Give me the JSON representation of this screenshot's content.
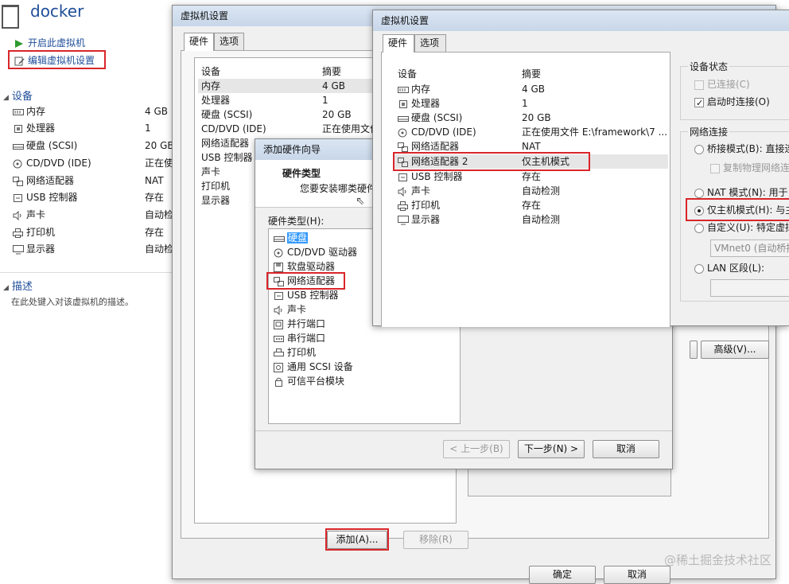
{
  "left_panel": {
    "vm_name": "docker",
    "actions": [
      {
        "label": "开启此虚拟机",
        "icon": "play-icon"
      },
      {
        "label": "编辑虚拟机设置",
        "icon": "edit-settings-icon"
      }
    ],
    "devices_section": "设备",
    "devices": [
      {
        "name": "内存",
        "value": "4 GB",
        "icon": "memory-icon"
      },
      {
        "name": "处理器",
        "value": "1",
        "icon": "processor-icon"
      },
      {
        "name": "硬盘 (SCSI)",
        "value": "20 GB",
        "icon": "hard-disk-icon"
      },
      {
        "name": "CD/DVD (IDE)",
        "value": "正在使",
        "icon": "cd-dvd-icon"
      },
      {
        "name": "网络适配器",
        "value": "NAT",
        "icon": "network-adapter-icon"
      },
      {
        "name": "USB 控制器",
        "value": "存在",
        "icon": "usb-icon"
      },
      {
        "name": "声卡",
        "value": "自动检",
        "icon": "sound-card-icon"
      },
      {
        "name": "打印机",
        "value": "存在",
        "icon": "printer-icon"
      },
      {
        "name": "显示器",
        "value": "自动检",
        "icon": "display-icon"
      }
    ],
    "description_section": "描述",
    "description_placeholder": "在此处键入对该虚拟机的描述。"
  },
  "settings_dialog": {
    "title": "虚拟机设置",
    "tabs": [
      "硬件",
      "选项"
    ],
    "col_device": "设备",
    "col_summary": "摘要",
    "devices": [
      {
        "name": "内存",
        "summary": "4 GB"
      },
      {
        "name": "处理器",
        "summary": "1"
      },
      {
        "name": "硬盘 (SCSI)",
        "summary": "20 GB"
      },
      {
        "name": "CD/DVD (IDE)",
        "summary": "正在使用文件"
      },
      {
        "name": "网络适配器",
        "summary": ""
      },
      {
        "name": "USB 控制器",
        "summary": ""
      },
      {
        "name": "声卡",
        "summary": ""
      },
      {
        "name": "打印机",
        "summary": ""
      },
      {
        "name": "显示器",
        "summary": ""
      }
    ],
    "add_button": "添加(A)...",
    "remove_button": "移除(R)",
    "advanced_button": "高级(V)...",
    "ok_button": "确定",
    "cancel_button": "取消"
  },
  "add_hardware_wizard": {
    "title": "添加硬件向导",
    "heading": "硬件类型",
    "subheading": "您要安装哪类硬件",
    "list_label": "硬件类型(H):",
    "types": [
      {
        "label": "硬盘",
        "icon": "hard-disk-icon"
      },
      {
        "label": "CD/DVD 驱动器",
        "icon": "cd-dvd-icon"
      },
      {
        "label": "软盘驱动器",
        "icon": "floppy-icon"
      },
      {
        "label": "网络适配器",
        "icon": "network-adapter-icon"
      },
      {
        "label": "USB 控制器",
        "icon": "usb-icon"
      },
      {
        "label": "声卡",
        "icon": "sound-card-icon"
      },
      {
        "label": "并行端口",
        "icon": "parallel-port-icon"
      },
      {
        "label": "串行端口",
        "icon": "serial-port-icon"
      },
      {
        "label": "打印机",
        "icon": "printer-icon"
      },
      {
        "label": "通用 SCSI 设备",
        "icon": "scsi-icon"
      },
      {
        "label": "可信平台模块",
        "icon": "tpm-icon"
      }
    ],
    "back_button": "< 上一步(B)",
    "next_button": "下一步(N) >",
    "cancel_button": "取消"
  },
  "front_dialog": {
    "title": "虚拟机设置",
    "tabs": [
      "硬件",
      "选项"
    ],
    "col_device": "设备",
    "col_summary": "摘要",
    "devices": [
      {
        "name": "内存",
        "summary": "4 GB",
        "icon": "memory-icon"
      },
      {
        "name": "处理器",
        "summary": "1",
        "icon": "processor-icon"
      },
      {
        "name": "硬盘 (SCSI)",
        "summary": "20 GB",
        "icon": "hard-disk-icon"
      },
      {
        "name": "CD/DVD (IDE)",
        "summary": "正在使用文件 E:\\framework\\7 ...",
        "icon": "cd-dvd-icon"
      },
      {
        "name": "网络适配器",
        "summary": "NAT",
        "icon": "network-adapter-icon"
      },
      {
        "name": "网络适配器 2",
        "summary": "仅主机模式",
        "icon": "network-adapter-icon"
      },
      {
        "name": "USB 控制器",
        "summary": "存在",
        "icon": "usb-icon"
      },
      {
        "name": "声卡",
        "summary": "自动检测",
        "icon": "sound-card-icon"
      },
      {
        "name": "打印机",
        "summary": "存在",
        "icon": "printer-icon"
      },
      {
        "name": "显示器",
        "summary": "自动检测",
        "icon": "display-icon"
      }
    ],
    "device_status": {
      "label": "设备状态",
      "connected": "已连接(C)",
      "connect_at_power_on": "启动时连接(O)"
    },
    "network_connection": {
      "label": "网络连接",
      "bridged": "桥接模式(B): 直接连",
      "replicate": "复制物理网络连",
      "nat": "NAT 模式(N): 用于",
      "host_only": "仅主机模式(H): 与主",
      "custom": "自定义(U): 特定虚拟",
      "custom_combo": "VMnet0 (自动桥接",
      "lan_segment": "LAN 区段(L):"
    }
  },
  "watermark": "@稀土掘金技术社区"
}
